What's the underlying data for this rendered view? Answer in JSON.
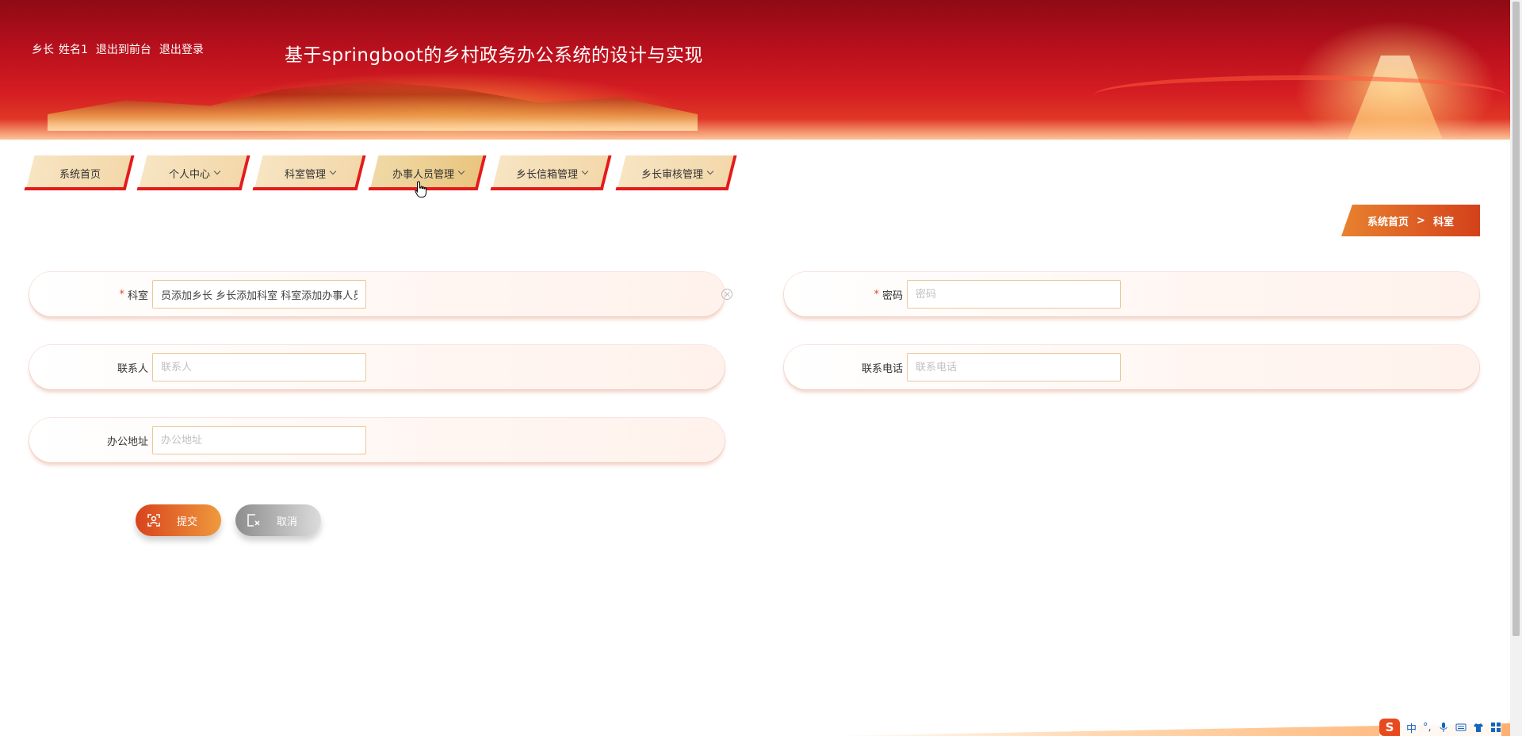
{
  "header": {
    "user_role": "乡长",
    "user_name": "姓名1",
    "back_to_front": "退出到前台",
    "logout": "退出登录",
    "site_title": "基于springboot的乡村政务办公系统的设计与实现"
  },
  "nav": {
    "items": [
      {
        "label": "系统首页",
        "has_dropdown": false
      },
      {
        "label": "个人中心",
        "has_dropdown": true
      },
      {
        "label": "科室管理",
        "has_dropdown": true
      },
      {
        "label": "办事人员管理",
        "has_dropdown": true
      },
      {
        "label": "乡长信箱管理",
        "has_dropdown": true
      },
      {
        "label": "乡长审核管理",
        "has_dropdown": true
      }
    ]
  },
  "breadcrumb": {
    "home": "系统首页",
    "separator": ">",
    "current": "科室"
  },
  "form": {
    "dept": {
      "label": "科室",
      "required": true,
      "value": "员添加乡长 乡长添加科室 科室添加办事人员",
      "placeholder": ""
    },
    "password": {
      "label": "密码",
      "required": true,
      "value": "",
      "placeholder": "密码"
    },
    "contact": {
      "label": "联系人",
      "required": false,
      "value": "",
      "placeholder": "联系人"
    },
    "phone": {
      "label": "联系电话",
      "required": false,
      "value": "",
      "placeholder": "联系电话"
    },
    "address": {
      "label": "办公地址",
      "required": false,
      "value": "",
      "placeholder": "办公地址"
    }
  },
  "buttons": {
    "submit": "提交",
    "cancel": "取消"
  },
  "ime": {
    "logo": "S",
    "mode": "中",
    "punct": "°,"
  },
  "colors": {
    "accent": "#e8461e",
    "banner_red": "#c8141e",
    "nav_bg": "#f5deb3",
    "nav_border": "#e51a1a"
  }
}
